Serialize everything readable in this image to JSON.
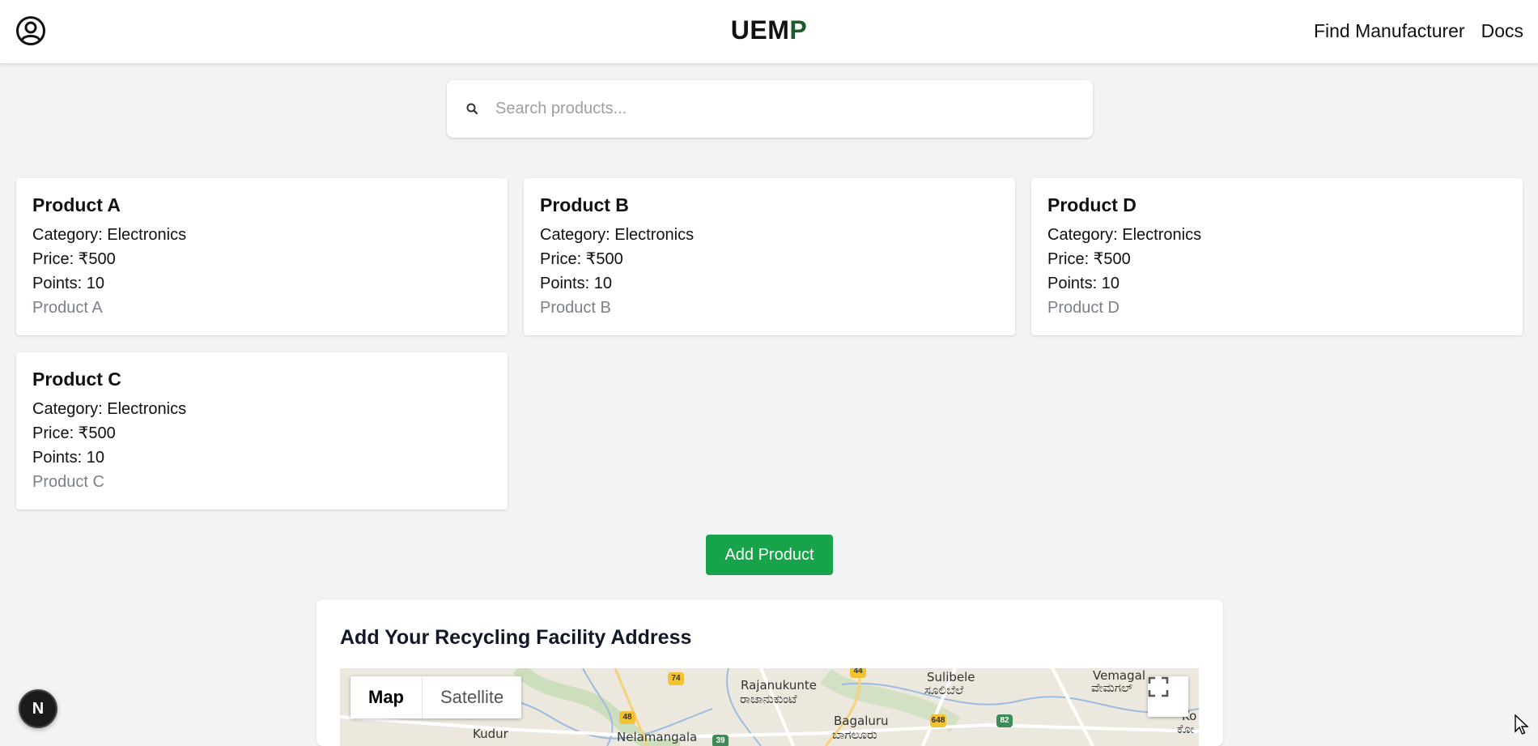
{
  "header": {
    "brand_main": "UEM",
    "brand_accent": "P",
    "nav": [
      "Find Manufacturer",
      "Docs"
    ]
  },
  "search": {
    "placeholder": "Search products..."
  },
  "products": [
    {
      "title": "Product A",
      "category": "Category: Electronics",
      "price": "Price: ₹500",
      "points": "Points: 10",
      "description": "Product A"
    },
    {
      "title": "Product B",
      "category": "Category: Electronics",
      "price": "Price: ₹500",
      "points": "Points: 10",
      "description": "Product B"
    },
    {
      "title": "Product D",
      "category": "Category: Electronics",
      "price": "Price: ₹500",
      "points": "Points: 10",
      "description": "Product D"
    },
    {
      "title": "Product C",
      "category": "Category: Electronics",
      "price": "Price: ₹500",
      "points": "Points: 10",
      "description": "Product C"
    }
  ],
  "add_button": "Add Product",
  "facility": {
    "heading": "Add Your Recycling Facility Address",
    "map_types": [
      "Map",
      "Satellite"
    ],
    "places": [
      "Rajanukunte",
      "ರಾಜಾನುಕುಂಟೆ",
      "Sulibele",
      "ಸೂಲಿಬೆಲೆ",
      "Vemagal",
      "ವೇಮಗಲ್",
      "Kudur",
      "Nelamangala",
      "Bagaluru",
      "ಬಾಗಲೂರು",
      "Ko",
      "ಕೋ"
    ],
    "routes": [
      "74",
      "44",
      "48",
      "39",
      "648",
      "82"
    ]
  },
  "dev_badge": "N",
  "colors": {
    "accent_green": "#16a34a",
    "brand_accent": "#1f5a2e",
    "background": "#f2f3f5"
  }
}
